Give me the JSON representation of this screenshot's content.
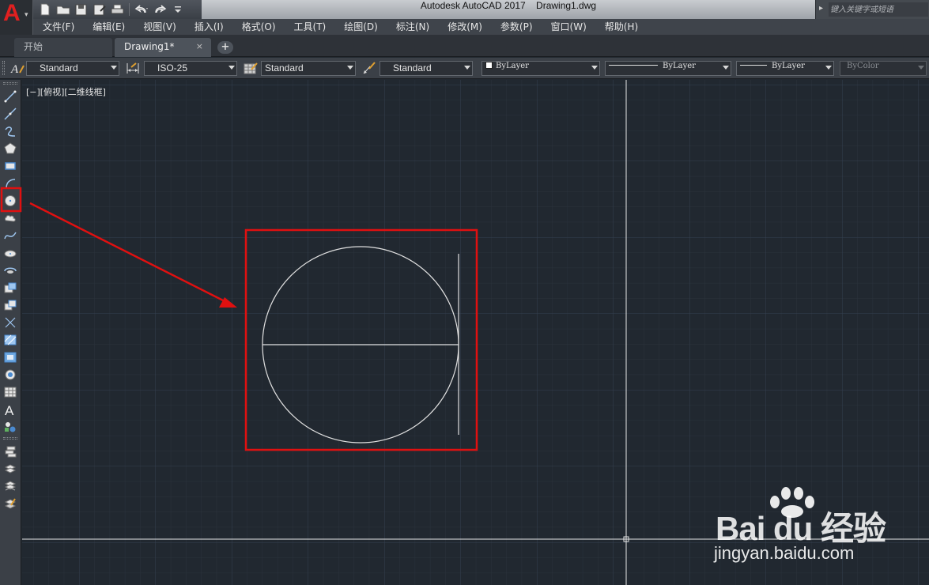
{
  "titlebar": {
    "app_name": "Autodesk AutoCAD 2017",
    "file_name": "Drawing1.dwg",
    "search_placeholder": "键入关键字或短语"
  },
  "quick_access": [
    "new-file-icon",
    "open-folder-icon",
    "save-icon",
    "save-as-icon",
    "print-icon",
    "undo-icon",
    "redo-icon",
    "customize-icon"
  ],
  "menu": [
    "文件(F)",
    "编辑(E)",
    "视图(V)",
    "插入(I)",
    "格式(O)",
    "工具(T)",
    "绘图(D)",
    "标注(N)",
    "修改(M)",
    "参数(P)",
    "窗口(W)",
    "帮助(H)"
  ],
  "tabs": [
    {
      "label": "开始",
      "active": false
    },
    {
      "label": "Drawing1*",
      "active": true,
      "close": "×"
    }
  ],
  "tab_add": "+",
  "properties": {
    "text_style": "Standard",
    "dim_style": "ISO-25",
    "table_style": "Standard",
    "multileader_style": "Standard",
    "color": "ByLayer",
    "linetype": "ByLayer",
    "lineweight": "ByLayer",
    "plot_style": "ByColor"
  },
  "left_tools": [
    "line-icon",
    "construction-line-icon",
    "polyline-icon",
    "polygon-icon",
    "rectangle-icon",
    "arc-icon",
    "circle-icon",
    "revision-cloud-icon",
    "spline-icon",
    "ellipse-icon",
    "ellipse-arc-icon",
    "insert-block-icon",
    "make-block-icon",
    "point-icon",
    "hatch-icon",
    "gradient-icon",
    "region-icon",
    "table-icon",
    "multiline-text-icon",
    "add-selected-icon",
    "layer-icon-1",
    "layer-icon-2",
    "layer-icon-3",
    "layer-icon-4"
  ],
  "viewport_label": "[−][俯视][二维线框]",
  "highlight_color": "#e01010",
  "canvas_bg": "#212830",
  "watermark": {
    "brand": "Bai du 经验",
    "url": "jingyan.baidu.com"
  }
}
